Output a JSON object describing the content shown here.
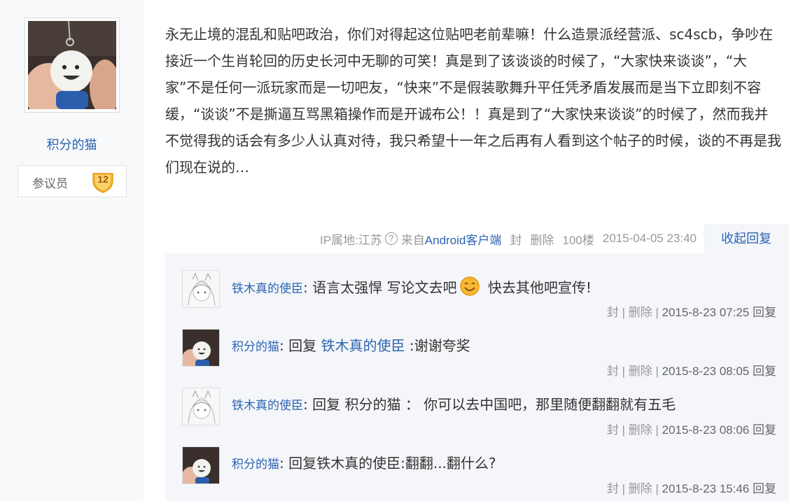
{
  "user": {
    "name": "积分的猫",
    "rank_title": "参议员",
    "level": "12"
  },
  "post": {
    "content": "永无止境的混乱和贴吧政治，你们对得起这位贴吧老前辈嘛！什么造景派经营派、sc4scb，争吵在接近一个生肖轮回的历史长河中无聊的可笑！真是到了该谈谈的时候了，“大家快来谈谈”，“大家”不是任何一派玩家而是一切吧友，“快来”不是假装歌舞升平任凭矛盾发展而是当下立即刻不容缓，“谈谈”不是撕逼互骂黑箱操作而是开诚布公！！真是到了“大家快来谈谈”的时候了，然而我并不觉得我的话会有多少人认真对待，我只希望十一年之后再有人看到这个帖子的时候，谈的不再是我们现在说的…"
  },
  "tail": {
    "ip_label": "IP属地:江苏",
    "help_icon": "?",
    "from_prefix": "来自",
    "client": "Android客户端",
    "block": "封",
    "delete": "删除",
    "floor": "100楼",
    "time": "2015-04-05 23:40",
    "collapse": "收起回复"
  },
  "replies": [
    {
      "user": "铁木真的使臣",
      "sep": ":",
      "text1": " 语言太强悍 写论文去吧",
      "emoji": "smile-emoji",
      "text2": " 快去其他吧宣传!",
      "block": "封",
      "delete": "删除",
      "time": "2015-8-23 07:25",
      "reply": "回复",
      "avatar": "anime-girl"
    },
    {
      "user": "积分的猫",
      "sep": ":",
      "prefix": " 回复 ",
      "target": "铁木真的使臣",
      "text1": " :谢谢夸奖",
      "block": "封",
      "delete": "删除",
      "time": "2015-8-23 08:05",
      "reply": "回复",
      "avatar": "doll"
    },
    {
      "user": "铁木真的使臣",
      "sep": ":",
      "text1": " 回复 积分的猫 ： 你可以去中国吧，那里随便翻翻就有五毛",
      "block": "封",
      "delete": "删除",
      "time": "2015-8-23 08:06",
      "reply": "回复",
      "avatar": "anime-girl"
    },
    {
      "user": "积分的猫",
      "sep": ":",
      "text1": " 回复铁木真的使臣:翻翻...翻什么?",
      "block": "封",
      "delete": "删除",
      "time": "2015-8-23 15:46",
      "reply": "回复",
      "avatar": "doll"
    }
  ],
  "colors": {
    "link": "#2d64b3",
    "panel": "#f4f6f9",
    "sidebar": "#f7f9fb",
    "meta": "#999999"
  }
}
